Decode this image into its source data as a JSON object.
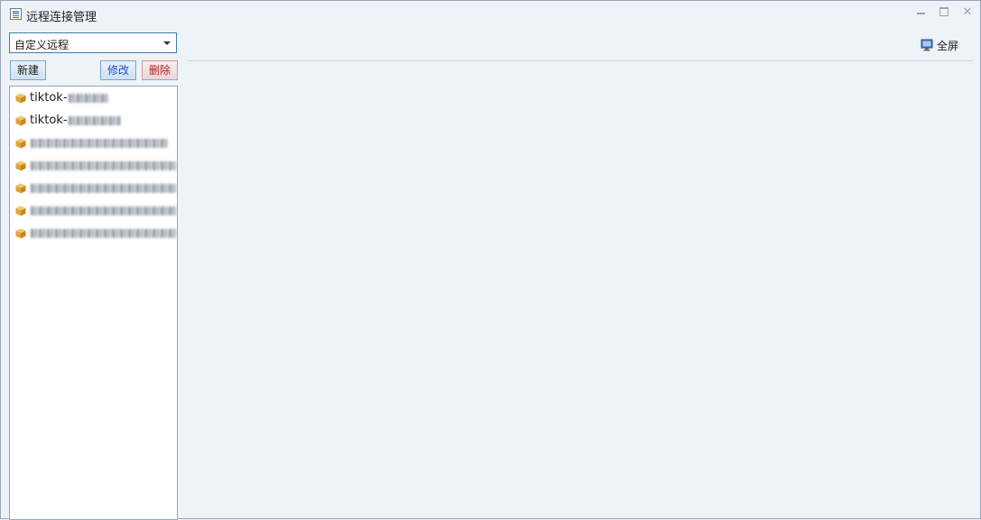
{
  "window": {
    "title": "远程连接管理",
    "controls": {
      "minimize": "minimize-icon",
      "maximize": "maximize-icon",
      "close": "close-icon"
    }
  },
  "sidebar": {
    "type_select": {
      "value": "自定义远程"
    },
    "buttons": {
      "new": "新建",
      "edit": "修改",
      "delete": "删除"
    },
    "connections": [
      {
        "prefix": "tiktok-"
      },
      {
        "prefix": "tiktok-"
      },
      {
        "prefix": ""
      },
      {
        "prefix": ""
      },
      {
        "prefix": ""
      },
      {
        "prefix": ""
      },
      {
        "prefix": ""
      }
    ]
  },
  "main": {
    "fullscreen_label": "全屏"
  },
  "colors": {
    "background": "#eef3f8",
    "accent_border": "#3c7fb1",
    "edit_text": "#1f4fc8",
    "delete_text": "#b02020"
  }
}
